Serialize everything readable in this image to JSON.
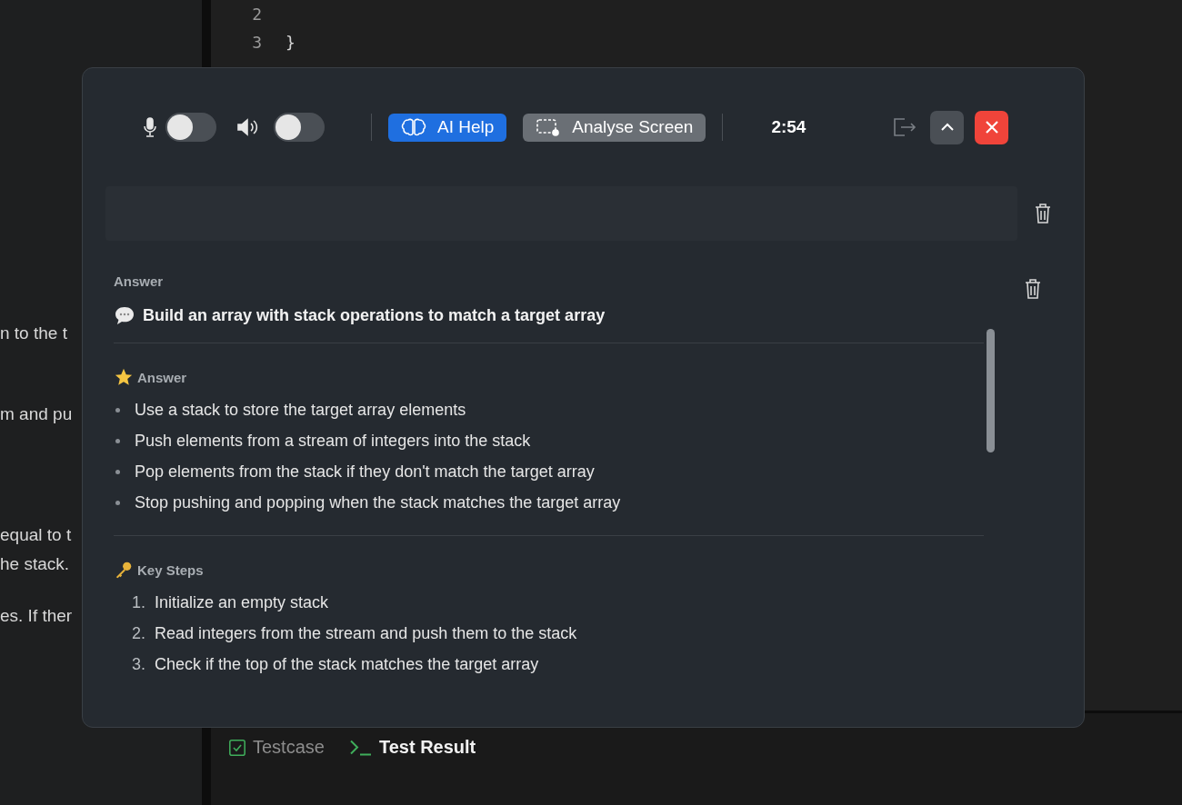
{
  "background": {
    "left_panel_lines": [
      "n to the t",
      "m and pu",
      "equal to  t",
      "he stack.",
      "es. If ther"
    ],
    "code_lines": [
      {
        "number": "2"
      },
      {
        "number": "3",
        "code": "}"
      }
    ],
    "bottom_tabs": [
      {
        "label": "Testcase",
        "kind": "testcase",
        "selected": false
      },
      {
        "label": "Test Result",
        "kind": "result",
        "selected": true
      }
    ]
  },
  "overlay": {
    "toolbar": {
      "mic_on": false,
      "speaker_on": false,
      "modes": [
        {
          "label": "AI Help",
          "kind": "brain",
          "selected": true
        },
        {
          "label": "Analyse Screen",
          "kind": "screen",
          "selected": false
        }
      ],
      "timer": "2:54"
    },
    "answer": {
      "label": "Answer",
      "title": "Build an array with stack operations to match a target array",
      "sections": [
        {
          "kind": "bullets",
          "heading": "Answer",
          "items": [
            "Use a stack to store the target array elements",
            "Push elements from a stream of integers into the stack",
            "Pop elements from the stack if they don't match the target array",
            "Stop pushing and popping when the stack matches the target array"
          ]
        },
        {
          "kind": "numbered",
          "heading": "Key Steps",
          "items": [
            {
              "number": "1.",
              "text": "Initialize an empty stack"
            },
            {
              "number": "2.",
              "text": "Read integers from the stream and push them to the stack"
            },
            {
              "number": "3.",
              "text": "Check if the top of the stack matches the target array"
            }
          ]
        }
      ]
    }
  }
}
